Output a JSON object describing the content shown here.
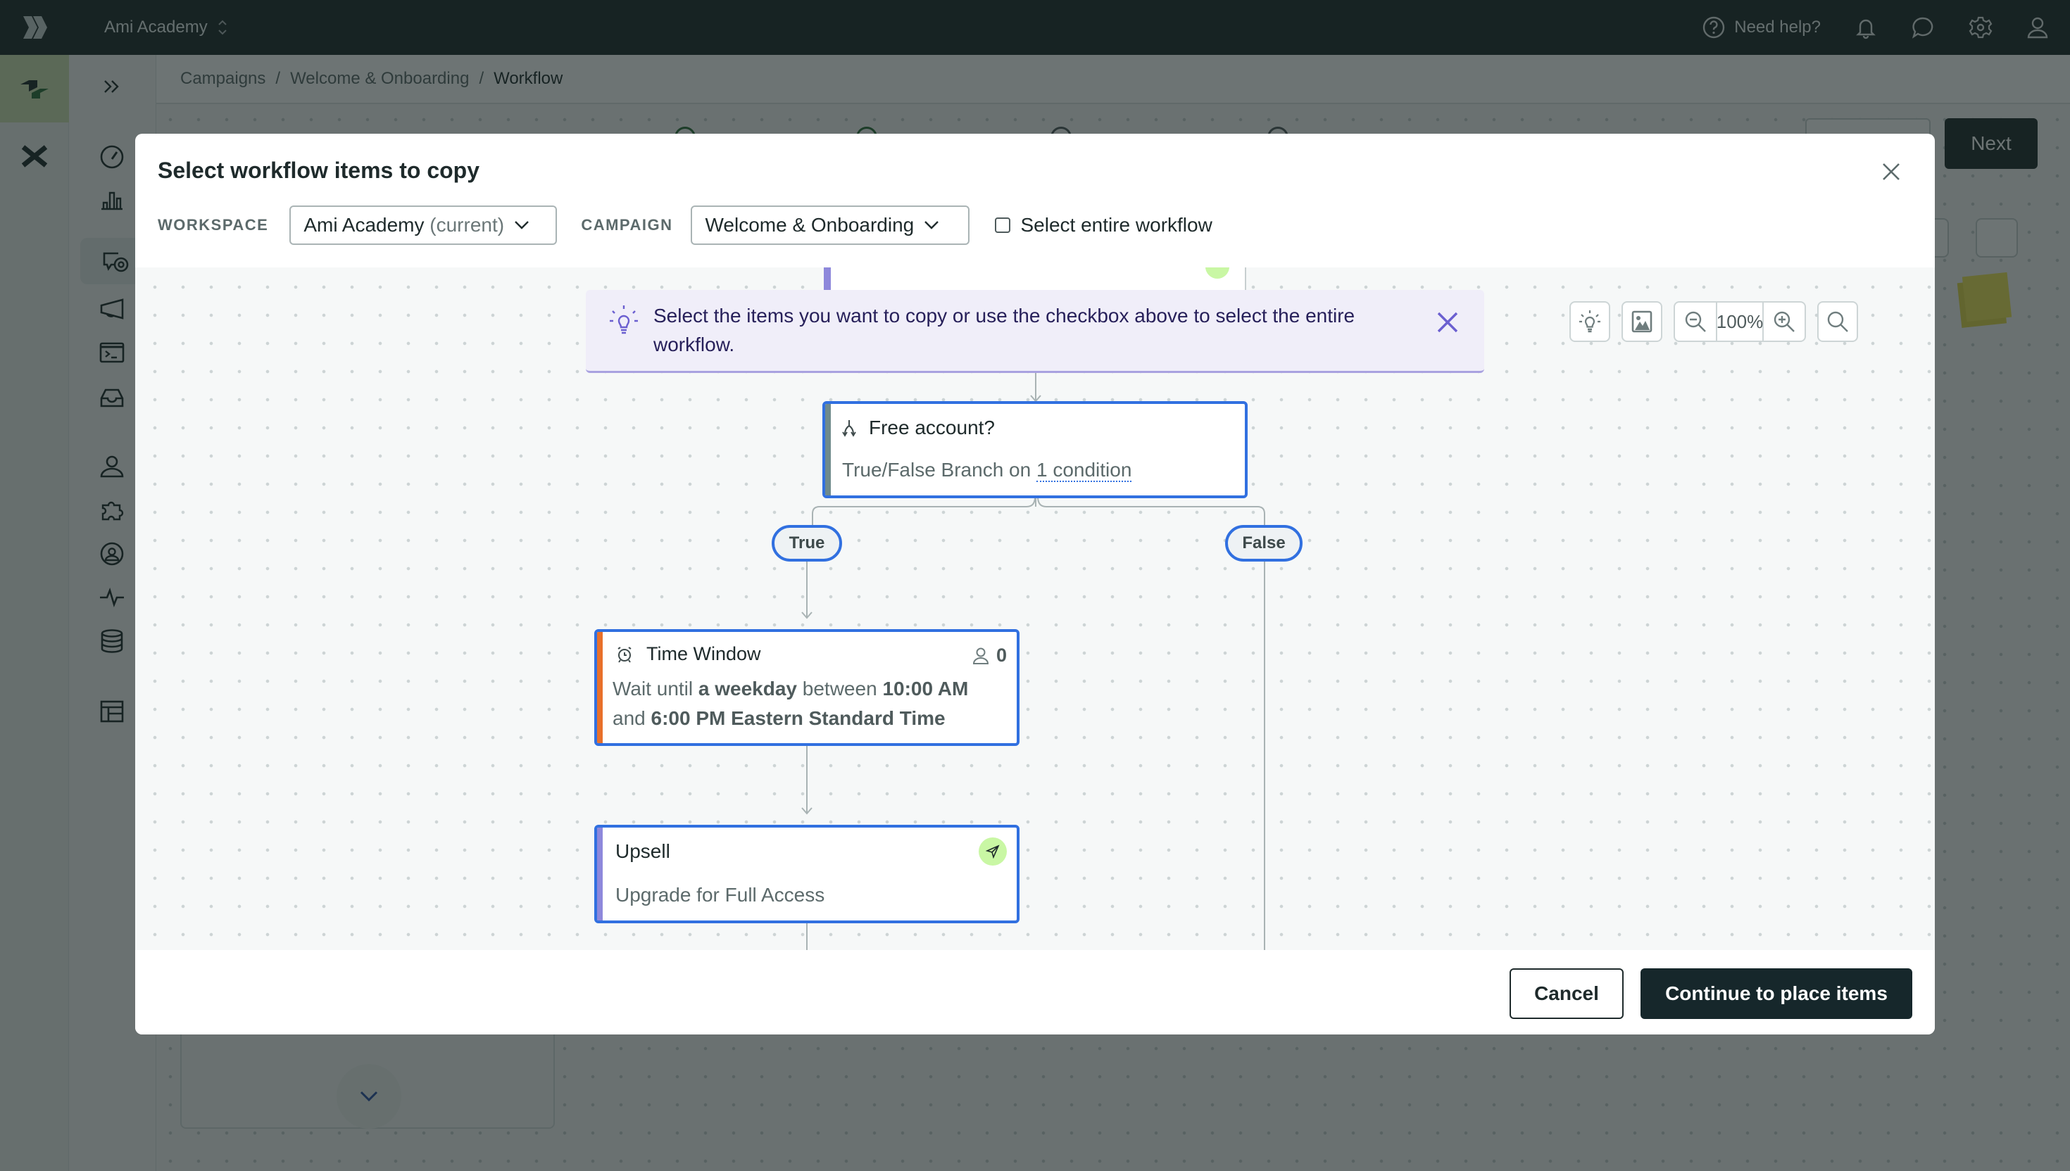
{
  "app": {
    "workspace_name": "Ami Academy",
    "help_label": "Need help?",
    "top_icons": [
      "help-circle-icon",
      "bell-icon",
      "chat-icon",
      "gear-icon",
      "user-icon"
    ]
  },
  "breadcrumb": [
    {
      "label": "Campaigns"
    },
    {
      "label": "Welcome & Onboarding"
    },
    {
      "label": "Workflow"
    }
  ],
  "breadcrumb_separator": "/",
  "background": {
    "next_label": "Next"
  },
  "sidebar": {
    "rail_items": [
      "journeys-logo-icon",
      "close-x-icon"
    ],
    "nav_items": [
      {
        "icon": "expand-chevrons-icon"
      },
      {
        "icon": "dashboard-gauge-icon"
      },
      {
        "icon": "bar-chart-icon"
      },
      {
        "icon": "campaigns-icon",
        "selected": true
      },
      {
        "icon": "megaphone-icon"
      },
      {
        "icon": "terminal-icon"
      },
      {
        "icon": "inbox-icon"
      },
      {
        "icon": "person-icon"
      },
      {
        "icon": "puzzle-icon"
      },
      {
        "icon": "user-circle-icon"
      },
      {
        "icon": "activity-icon"
      },
      {
        "icon": "database-icon"
      },
      {
        "icon": "layout-table-icon"
      }
    ]
  },
  "modal": {
    "title": "Select workflow items to copy",
    "workspace_label": "WORKSPACE",
    "workspace_value": "Ami Academy",
    "workspace_suffix": "(current)",
    "campaign_label": "CAMPAIGN",
    "campaign_value": "Welcome & Onboarding",
    "select_entire_label": "Select entire workflow",
    "select_entire_checked": false,
    "tip_text": "Select the items you want to copy or use the checkbox above to select the entire workflow.",
    "zoom_level": "100%",
    "cancel_label": "Cancel",
    "continue_label": "Continue to place items"
  },
  "workflow": {
    "branch_node": {
      "title": "Free account?",
      "sub_prefix": "True/False Branch on",
      "condition_link": "1 condition"
    },
    "true_label": "True",
    "false_label": "False",
    "time_window": {
      "title": "Time Window",
      "people_count": "0",
      "line1_a": "Wait until",
      "line1_b": "a weekday",
      "line1_c": "between",
      "line1_d": "10:00 AM",
      "line2_a": "and",
      "line2_b": "6:00 PM Eastern Standard Time"
    },
    "upsell": {
      "title": "Upsell",
      "subtitle": "Upgrade for Full Access"
    }
  },
  "colors": {
    "selected_border": "#3170e0",
    "time_window_stripe": "#e8702a",
    "message_stripe": "#8e88db",
    "branch_stripe": "#6f8a8c",
    "primary_button": "#16272b",
    "tip_background": "#f0eef9"
  }
}
